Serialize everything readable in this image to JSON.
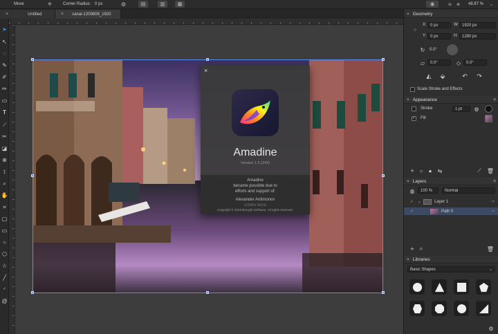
{
  "toolbar": {
    "mode_label": "Move",
    "corner_radius_label": "Corner Radius:",
    "corner_radius_value": "0 px",
    "zoom_value": "48.87 %"
  },
  "tabs": [
    {
      "label": "Untitled"
    },
    {
      "label": "canal-1209808_1920"
    }
  ],
  "about": {
    "app_name": "Amadine",
    "version": "Version 1.5 (243)",
    "made_possible": "Amadine",
    "made_possible_line2": "became possible due to",
    "made_possible_line3": "efforts and support of:",
    "credit_name": "Alexander Antimonov",
    "credit_name_2": "Dmitry Bura",
    "copyright": "Copyright © 2023 BeLight Software. All rights reserved."
  },
  "geometry": {
    "title": "Geometry",
    "x_label": "X:",
    "x_value": "0 px",
    "y_label": "Y:",
    "y_value": "0 px",
    "w_label": "W:",
    "w_value": "1920 px",
    "h_label": "H:",
    "h_value": "1280 px",
    "rotation": "0.0°",
    "shear_a": "0.0°",
    "shear_b": "0.0°",
    "scale_stroke_label": "Scale Stroke and Effects"
  },
  "appearance": {
    "title": "Appearance",
    "stroke_label": "Stroke",
    "stroke_width": "1 pt",
    "fill_label": "Fill"
  },
  "layers": {
    "title": "Layers",
    "opacity": "100 %",
    "blend_mode": "Normal",
    "items": [
      {
        "label": "Layer 1"
      },
      {
        "label": "Path 0"
      }
    ]
  },
  "libraries": {
    "title": "Libraries",
    "category": "Basic Shapes"
  },
  "colors": {
    "accent": "#4a8ef0",
    "selection": "#5b8ef0"
  }
}
